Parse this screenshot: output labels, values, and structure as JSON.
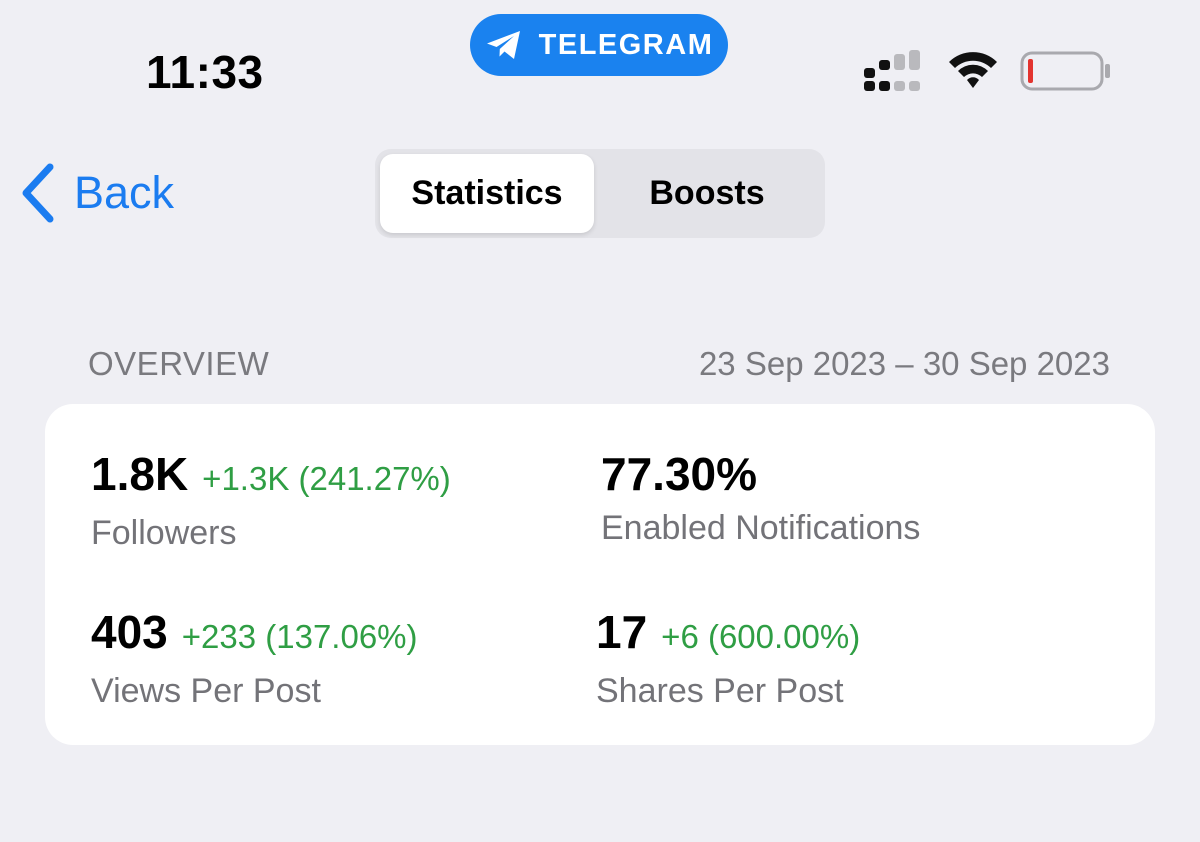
{
  "status_bar": {
    "time": "11:33",
    "app_pill": {
      "label": "TELEGRAM",
      "icon": "telegram-plane-icon",
      "color": "#1a82ef"
    },
    "icons": [
      "cellular-signal-icon",
      "wifi-icon",
      "battery-low-icon"
    ],
    "battery_color": "#e3342f"
  },
  "nav": {
    "back_label": "Back",
    "tabs": [
      {
        "label": "Statistics",
        "active": true
      },
      {
        "label": "Boosts",
        "active": false
      }
    ],
    "accent": "#1b7cf0"
  },
  "overview": {
    "title": "OVERVIEW",
    "date_range": "23 Sep 2023 – 30 Sep 2023",
    "stats": [
      {
        "value": "1.8K",
        "delta": "+1.3K (241.27%)",
        "label": "Followers"
      },
      {
        "value": "77.30%",
        "delta": "",
        "label": "Enabled Notifications"
      },
      {
        "value": "403",
        "delta": "+233 (137.06%)",
        "label": "Views Per Post"
      },
      {
        "value": "17",
        "delta": "+6 (600.00%)",
        "label": "Shares Per Post"
      }
    ],
    "positive_color": "#2f9e44"
  }
}
